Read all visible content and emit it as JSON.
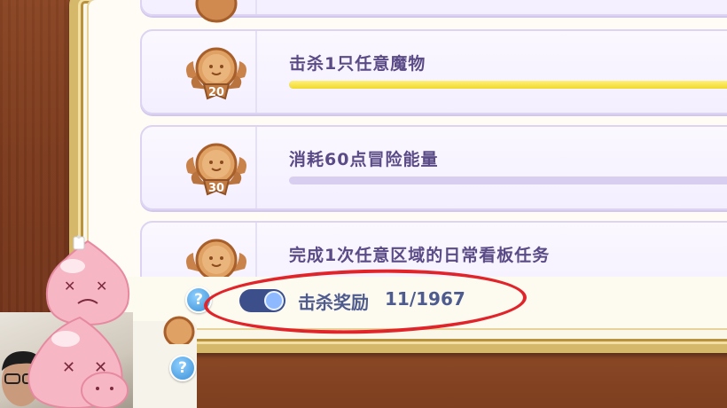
{
  "tasks": [
    {
      "title": "击杀1只任意魔物",
      "badge": "20",
      "progress": 1.0
    },
    {
      "title": "消耗60点冒险能量",
      "badge": "30",
      "progress": 0.0
    },
    {
      "title": "完成1次任意区域的日常看板任务",
      "badge": "",
      "progress": 0.0
    }
  ],
  "footer": {
    "toggle_on": true,
    "reward_label": "击杀奖励",
    "reward_count": "11/1967",
    "help_glyph": "?"
  },
  "colors": {
    "accent_yellow": "#f0d92c",
    "title_purple": "#5a4b86",
    "highlight_red": "#e0242a"
  },
  "icons": [
    "medal-icon",
    "help-icon",
    "toggle-switch",
    "pink-poring-mascot"
  ]
}
